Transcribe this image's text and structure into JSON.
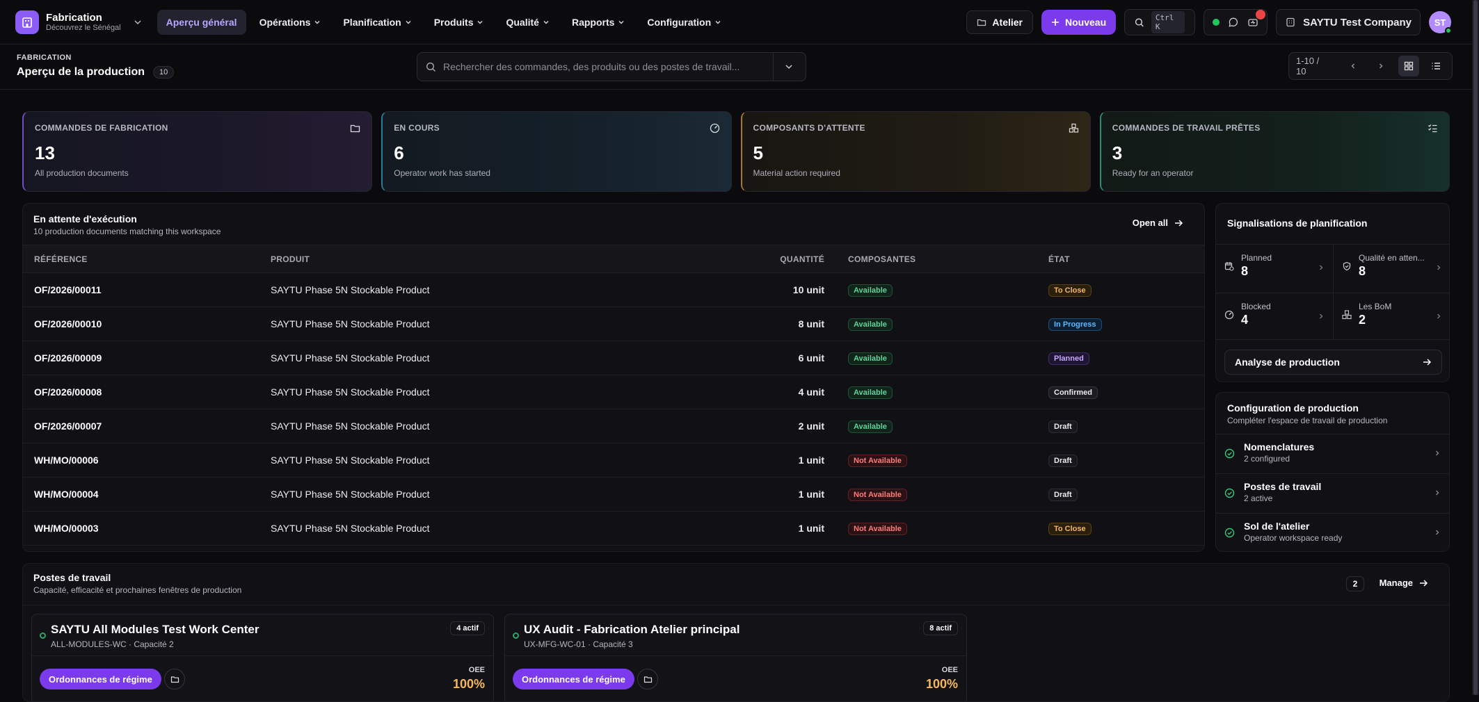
{
  "app": {
    "name": "Fabrication",
    "subtitle": "Découvrez le Sénégal"
  },
  "nav": [
    "Aperçu général",
    "Opérations",
    "Planification",
    "Produits",
    "Qualité",
    "Rapports",
    "Configuration"
  ],
  "top": {
    "atelier": "Atelier",
    "new": "Nouveau",
    "shortcut": "Ctrl K",
    "notification_count": "",
    "company": "SAYTU Test Company",
    "avatar_initials": "ST"
  },
  "page": {
    "breadcrumb": "FABRICATION",
    "title": "Aperçu de la production",
    "count": "10",
    "search_placeholder": "Rechercher des commandes, des produits ou des postes de travail...",
    "pager": "1-10 / 10"
  },
  "kpis": [
    {
      "label": "COMMANDES DE FABRICATION",
      "value": "13",
      "desc": "All production documents",
      "icon": "folder-icon"
    },
    {
      "label": "EN COURS",
      "value": "6",
      "desc": "Operator work has started",
      "icon": "gauge-icon"
    },
    {
      "label": "COMPOSANTS D'ATTENTE",
      "value": "5",
      "desc": "Material action required",
      "icon": "boxes-icon"
    },
    {
      "label": "COMMANDES DE TRAVAIL PRÊTES",
      "value": "3",
      "desc": "Ready for an operator",
      "icon": "checklist-icon"
    }
  ],
  "orders": {
    "title": "En attente d'exécution",
    "subtitle": "10 production documents matching this workspace",
    "open_all": "Open all",
    "columns": {
      "ref": "RÉFÉRENCE",
      "product": "PRODUIT",
      "qty": "QUANTITÉ",
      "components": "COMPOSANTES",
      "state": "ÉTAT"
    },
    "rows": [
      {
        "ref": "OF/2026/00011",
        "product": "SAYTU Phase 5N Stockable Product",
        "qty": "10 unit",
        "comp": "Available",
        "state": "To Close"
      },
      {
        "ref": "OF/2026/00010",
        "product": "SAYTU Phase 5N Stockable Product",
        "qty": "8 unit",
        "comp": "Available",
        "state": "In Progress"
      },
      {
        "ref": "OF/2026/00009",
        "product": "SAYTU Phase 5N Stockable Product",
        "qty": "6 unit",
        "comp": "Available",
        "state": "Planned"
      },
      {
        "ref": "OF/2026/00008",
        "product": "SAYTU Phase 5N Stockable Product",
        "qty": "4 unit",
        "comp": "Available",
        "state": "Confirmed"
      },
      {
        "ref": "OF/2026/00007",
        "product": "SAYTU Phase 5N Stockable Product",
        "qty": "2 unit",
        "comp": "Available",
        "state": "Draft"
      },
      {
        "ref": "WH/MO/00006",
        "product": "SAYTU Phase 5N Stockable Product",
        "qty": "1 unit",
        "comp": "Not Available",
        "state": "Draft"
      },
      {
        "ref": "WH/MO/00004",
        "product": "SAYTU Phase 5N Stockable Product",
        "qty": "1 unit",
        "comp": "Not Available",
        "state": "Draft"
      },
      {
        "ref": "WH/MO/00003",
        "product": "SAYTU Phase 5N Stockable Product",
        "qty": "1 unit",
        "comp": "Not Available",
        "state": "To Close"
      }
    ]
  },
  "signals": {
    "title": "Signalisations de planification",
    "items": [
      {
        "label": "Planned",
        "value": "8",
        "icon": "calendar-clock-icon"
      },
      {
        "label": "Qualité en atten...",
        "value": "8",
        "icon": "shield-check-icon"
      },
      {
        "label": "Blocked",
        "value": "4",
        "icon": "gauge-icon"
      },
      {
        "label": "Les BoM",
        "value": "2",
        "icon": "boxes-icon"
      }
    ],
    "analysis": "Analyse de production"
  },
  "setup": {
    "title": "Configuration de production",
    "subtitle": "Compléter l'espace de travail de production",
    "items": [
      {
        "title": "Nomenclatures",
        "sub": "2 configured"
      },
      {
        "title": "Postes de travail",
        "sub": "2 active"
      },
      {
        "title": "Sol de l'atelier",
        "sub": "Operator workspace ready"
      }
    ]
  },
  "workcenters": {
    "title": "Postes de travail",
    "subtitle": "Capacité, efficacité et prochaines fenêtres de production",
    "count": "2",
    "manage": "Manage",
    "cards": [
      {
        "name": "SAYTU All Modules Test Work Center",
        "meta": "ALL-MODULES-WC · Capacité 2",
        "active": "4 actif",
        "button": "Ordonnances de régime",
        "oee_label": "OEE",
        "oee": "100%"
      },
      {
        "name": "UX Audit - Fabrication Atelier principal",
        "meta": "UX-MFG-WC-01 · Capacité 3",
        "active": "8 actif",
        "button": "Ordonnances de régime",
        "oee_label": "OEE",
        "oee": "100%"
      }
    ]
  },
  "colors": {
    "accent": "#7c3aed",
    "available": "#5fd39b",
    "not_available": "#ff7b7b",
    "oee": "#f5b75a"
  }
}
